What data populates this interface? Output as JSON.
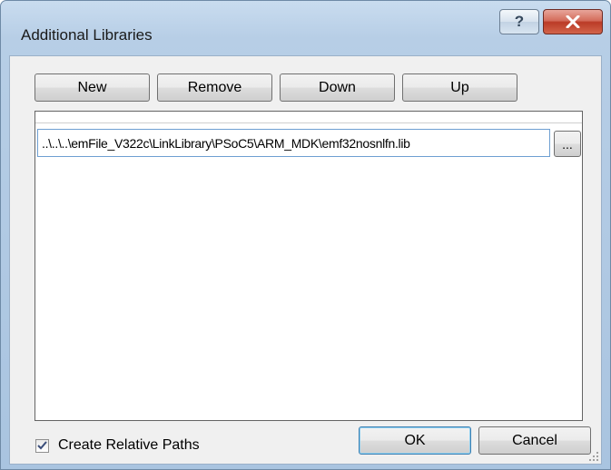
{
  "window": {
    "title": "Additional Libraries",
    "help_glyph": "?"
  },
  "toolbar": {
    "new_label": "New",
    "remove_label": "Remove",
    "down_label": "Down",
    "up_label": "Up"
  },
  "list": {
    "items": [
      {
        "path": "..\\..\\..\\emFile_V322c\\LinkLibrary\\PSoC5\\ARM_MDK\\emf32nosnlfn.lib",
        "browse_label": "..."
      }
    ]
  },
  "options": {
    "relative_paths_label": "Create Relative Paths",
    "relative_paths_checked": true
  },
  "footer": {
    "ok_label": "OK",
    "cancel_label": "Cancel"
  },
  "colors": {
    "close_accent": "#c8452f",
    "focus_border": "#3c7fb1"
  }
}
